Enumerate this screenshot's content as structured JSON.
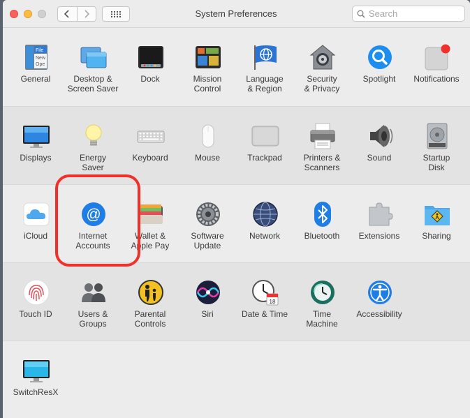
{
  "window": {
    "title": "System Preferences"
  },
  "search": {
    "placeholder": "Search"
  },
  "rows": [
    [
      {
        "name": "general",
        "label": "General",
        "icon": "general-icon"
      },
      {
        "name": "desktop-screen-saver",
        "label": "Desktop &\nScreen Saver",
        "icon": "desktop-screen-saver-icon"
      },
      {
        "name": "dock",
        "label": "Dock",
        "icon": "dock-icon"
      },
      {
        "name": "mission-control",
        "label": "Mission\nControl",
        "icon": "mission-control-icon"
      },
      {
        "name": "language-region",
        "label": "Language\n& Region",
        "icon": "flag-globe-icon"
      },
      {
        "name": "security-privacy",
        "label": "Security\n& Privacy",
        "icon": "house-lock-icon"
      },
      {
        "name": "spotlight",
        "label": "Spotlight",
        "icon": "magnifier-icon"
      },
      {
        "name": "notifications",
        "label": "Notifications",
        "icon": "notifications-icon"
      }
    ],
    [
      {
        "name": "displays",
        "label": "Displays",
        "icon": "monitor-icon"
      },
      {
        "name": "energy-saver",
        "label": "Energy\nSaver",
        "icon": "lightbulb-icon"
      },
      {
        "name": "keyboard",
        "label": "Keyboard",
        "icon": "keyboard-icon"
      },
      {
        "name": "mouse",
        "label": "Mouse",
        "icon": "mouse-icon"
      },
      {
        "name": "trackpad",
        "label": "Trackpad",
        "icon": "trackpad-icon"
      },
      {
        "name": "printers-scanners",
        "label": "Printers &\nScanners",
        "icon": "printer-icon"
      },
      {
        "name": "sound",
        "label": "Sound",
        "icon": "speaker-icon"
      },
      {
        "name": "startup-disk",
        "label": "Startup\nDisk",
        "icon": "hard-drive-icon"
      }
    ],
    [
      {
        "name": "icloud",
        "label": "iCloud",
        "icon": "cloud-icon"
      },
      {
        "name": "internet-accounts",
        "label": "Internet\nAccounts",
        "icon": "at-sign-icon"
      },
      {
        "name": "wallet-apple-pay",
        "label": "Wallet &\nApple Pay",
        "icon": "wallet-icon"
      },
      {
        "name": "software-update",
        "label": "Software\nUpdate",
        "icon": "gear-icon"
      },
      {
        "name": "network",
        "label": "Network",
        "icon": "network-globe-icon"
      },
      {
        "name": "bluetooth",
        "label": "Bluetooth",
        "icon": "bluetooth-icon"
      },
      {
        "name": "extensions",
        "label": "Extensions",
        "icon": "puzzle-piece-icon"
      },
      {
        "name": "sharing",
        "label": "Sharing",
        "icon": "sharing-folder-icon"
      }
    ],
    [
      {
        "name": "touch-id",
        "label": "Touch ID",
        "icon": "fingerprint-icon"
      },
      {
        "name": "users-groups",
        "label": "Users &\nGroups",
        "icon": "users-icon"
      },
      {
        "name": "parental-controls",
        "label": "Parental\nControls",
        "icon": "parental-controls-icon"
      },
      {
        "name": "siri",
        "label": "Siri",
        "icon": "siri-icon"
      },
      {
        "name": "date-time",
        "label": "Date & Time",
        "icon": "clock-calendar-icon"
      },
      {
        "name": "time-machine",
        "label": "Time\nMachine",
        "icon": "time-machine-icon"
      },
      {
        "name": "accessibility",
        "label": "Accessibility",
        "icon": "accessibility-icon"
      }
    ],
    [
      {
        "name": "switchresx",
        "label": "SwitchResX",
        "icon": "switchresx-monitor-icon"
      }
    ]
  ],
  "highlighted_pane": "internet-accounts",
  "highlight_color": "#f0302a",
  "notification_badge_color": "#f0302a"
}
